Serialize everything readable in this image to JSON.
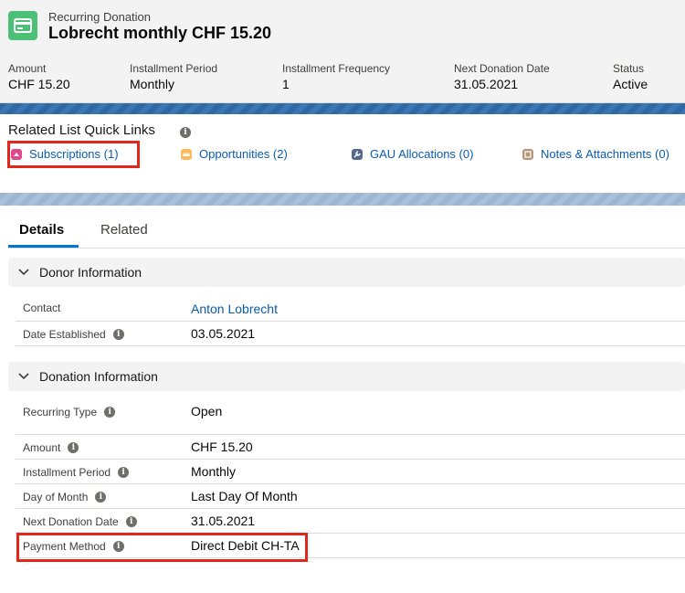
{
  "header": {
    "object_label": "Recurring Donation",
    "record_title": "Lobrecht monthly CHF 15.20",
    "icon": "recurring-donation-icon",
    "accent_color": "#4bc076"
  },
  "highlights": [
    {
      "label": "Amount",
      "value": "CHF 15.20"
    },
    {
      "label": "Installment Period",
      "value": "Monthly"
    },
    {
      "label": "Installment Frequency",
      "value": "1"
    },
    {
      "label": "Next Donation Date",
      "value": "31.05.2021"
    },
    {
      "label": "Status",
      "value": "Active"
    }
  ],
  "quick_links": {
    "title": "Related List Quick Links",
    "items": [
      {
        "label": "Subscriptions (1)",
        "icon": "subscription-icon",
        "color": "#e3478c"
      },
      {
        "label": "Opportunities (2)",
        "icon": "crown-icon",
        "color": "#fcb95b"
      },
      {
        "label": "GAU Allocations (0)",
        "icon": "wrench-icon",
        "color": "#54698d"
      },
      {
        "label": "Notes & Attachments (0)",
        "icon": "note-icon",
        "color": "#b5977c"
      }
    ]
  },
  "tabs": [
    {
      "label": "Details",
      "active": true
    },
    {
      "label": "Related",
      "active": false
    }
  ],
  "sections": [
    {
      "title": "Donor Information",
      "fields": [
        {
          "label": "Contact",
          "value": "Anton Lobrecht",
          "link": true,
          "info": false
        },
        {
          "label": "Date Established",
          "value": "03.05.2021",
          "link": false,
          "info": true
        }
      ]
    },
    {
      "title": "Donation Information",
      "fields": [
        {
          "label": "Recurring Type",
          "value": "Open",
          "info": true
        },
        {
          "label": "Amount",
          "value": "CHF 15.20",
          "info": true
        },
        {
          "label": "Installment Period",
          "value": "Monthly",
          "info": true
        },
        {
          "label": "Day of Month",
          "value": "Last Day Of Month",
          "info": true
        },
        {
          "label": "Next Donation Date",
          "value": "31.05.2021",
          "info": true
        },
        {
          "label": "Payment Method",
          "value": "Direct Debit CH-TA",
          "info": true
        }
      ]
    }
  ],
  "annotation_color": "#e2261c"
}
